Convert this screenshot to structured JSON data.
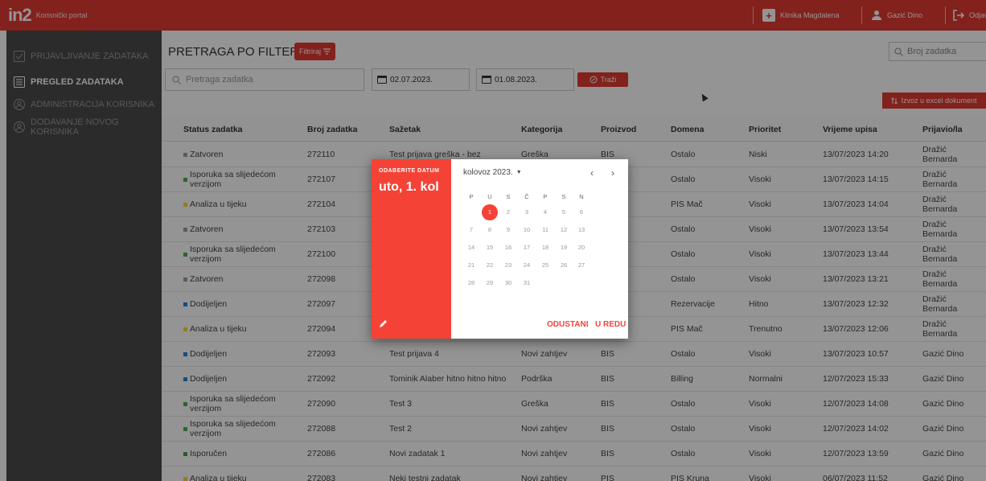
{
  "topbar": {
    "logo": "in2",
    "portal": "Korisnički portal",
    "clinic": "Klinika Magdalena",
    "user": "Gazić Dino",
    "logout": "Odjava"
  },
  "sidebar": {
    "items": [
      {
        "label": "PRIJAVLJIVANJE ZADATAKA",
        "icon": "task-icon"
      },
      {
        "label": "PREGLED ZADATAKA",
        "icon": "list-icon"
      },
      {
        "label": "ADMINISTRACIJA KORISNIKA",
        "icon": "users-icon"
      },
      {
        "label": "DODAVANJE NOVOG KORISNIKA",
        "icon": "add-user-icon"
      }
    ]
  },
  "main": {
    "title": "PRETRAGA PO FILTERIMA",
    "filter_label": "Filtriraj",
    "task_search_placeholder": "Pretraga zadatka",
    "number_search_placeholder": "Broj zadatka",
    "date_from": "02.07.2023.",
    "date_to": "01.08.2023.",
    "search_label": "Traži",
    "export_label": "Izvoz u excel dokument"
  },
  "table": {
    "headers": [
      "Status zadatka",
      "Broj zadatka",
      "Sažetak",
      "Kategorija",
      "Proizvod",
      "Domena",
      "Prioritet",
      "Vrijeme upisa",
      "Prijavio/la"
    ],
    "rows": [
      {
        "status": "Zatvoren",
        "color": "#9e9e9e",
        "num": "272110",
        "summary": "Test prijava greška - bez",
        "category": "Greška",
        "product": "BIS",
        "domain": "Ostalo",
        "priority": "Niski",
        "time": "13/07/2023 14:20",
        "reporter": "Dražić Bernarda"
      },
      {
        "status": "Isporuka sa slijedećom verzijom",
        "color": "#4caf50",
        "num": "272107",
        "summary": "",
        "category": "",
        "product": "",
        "domain": "Ostalo",
        "priority": "Visoki",
        "time": "13/07/2023 14:15",
        "reporter": "Dražić Bernarda"
      },
      {
        "status": "Analiza u tijeku",
        "color": "#fdd835",
        "num": "272104",
        "summary": "",
        "category": "",
        "product": "",
        "domain": "PIS Mač",
        "priority": "Visoki",
        "time": "13/07/2023 14:04",
        "reporter": "Dražić Bernarda"
      },
      {
        "status": "Zatvoren",
        "color": "#9e9e9e",
        "num": "272103",
        "summary": "",
        "category": "",
        "product": "",
        "domain": "Ostalo",
        "priority": "Visoki",
        "time": "13/07/2023 13:54",
        "reporter": "Dražić Bernarda"
      },
      {
        "status": "Isporuka sa slijedećom verzijom",
        "color": "#4caf50",
        "num": "272100",
        "summary": "",
        "category": "",
        "product": "",
        "domain": "Ostalo",
        "priority": "Visoki",
        "time": "13/07/2023 13:44",
        "reporter": "Dražić Bernarda"
      },
      {
        "status": "Zatvoren",
        "color": "#9e9e9e",
        "num": "272098",
        "summary": "",
        "category": "",
        "product": "",
        "domain": "Ostalo",
        "priority": "Visoki",
        "time": "13/07/2023 13:21",
        "reporter": "Dražić Bernarda"
      },
      {
        "status": "Dodijeljen",
        "color": "#1e88e5",
        "num": "272097",
        "summary": "",
        "category": "",
        "product": "",
        "domain": "Rezervacije",
        "priority": "Hitno",
        "time": "13/07/2023 12:32",
        "reporter": "Dražić Bernarda"
      },
      {
        "status": "Analiza u tijeku",
        "color": "#fdd835",
        "num": "272094",
        "summary": "",
        "category": "",
        "product": "",
        "domain": "PIS Mač",
        "priority": "Trenutno",
        "time": "13/07/2023 12:06",
        "reporter": "Dražić Bernarda"
      },
      {
        "status": "Dodijeljen",
        "color": "#1e88e5",
        "num": "272093",
        "summary": "Test prijava 4",
        "category": "Novi zahtjev",
        "product": "BIS",
        "domain": "Ostalo",
        "priority": "Visoki",
        "time": "13/07/2023 10:57",
        "reporter": "Gazić Dino"
      },
      {
        "status": "Dodijeljen",
        "color": "#1e88e5",
        "num": "272092",
        "summary": "Tominik Alaber hitno hitno hitno",
        "category": "Podrška",
        "product": "BIS",
        "domain": "Billing",
        "priority": "Normalni",
        "time": "12/07/2023 15:33",
        "reporter": "Gazić Dino"
      },
      {
        "status": "Isporuka sa slijedećom verzijom",
        "color": "#4caf50",
        "num": "272090",
        "summary": "Test 3",
        "category": "Greška",
        "product": "BIS",
        "domain": "Ostalo",
        "priority": "Visoki",
        "time": "12/07/2023 14:08",
        "reporter": "Gazić Dino"
      },
      {
        "status": "Isporuka sa slijedećom verzijom",
        "color": "#4caf50",
        "num": "272088",
        "summary": "Test 2",
        "category": "Novi zahtjev",
        "product": "BIS",
        "domain": "Ostalo",
        "priority": "Visoki",
        "time": "12/07/2023 14:02",
        "reporter": "Gazić Dino"
      },
      {
        "status": "Isporučen",
        "color": "#43a047",
        "num": "272086",
        "summary": "Novi zadatak 1",
        "category": "Novi zahtjev",
        "product": "BIS",
        "domain": "Ostalo",
        "priority": "Visoki",
        "time": "12/07/2023 13:59",
        "reporter": "Gazić Dino"
      },
      {
        "status": "Analiza u tijeku",
        "color": "#fdd835",
        "num": "272083",
        "summary": "Neki testni zadatak",
        "category": "Novi zahtjev",
        "product": "PIS",
        "domain": "PIS Kruna",
        "priority": "Visoki",
        "time": "06/07/2023 11:52",
        "reporter": "Gazić Dino"
      }
    ]
  },
  "datepicker": {
    "label": "ODABERITE DATUM",
    "selected_display": "uto, 1. kol",
    "month": "kolovoz 2023.",
    "weekdays": [
      "P",
      "U",
      "S",
      "Č",
      "P",
      "S",
      "N"
    ],
    "days": [
      "1",
      "2",
      "3",
      "4",
      "5",
      "6",
      "7",
      "8",
      "9",
      "10",
      "11",
      "12",
      "13",
      "14",
      "15",
      "16",
      "17",
      "18",
      "19",
      "20",
      "21",
      "22",
      "23",
      "24",
      "25",
      "26",
      "27",
      "28",
      "29",
      "30",
      "31"
    ],
    "selected_day": "1",
    "cancel": "ODUSTANI",
    "ok": "U REDU"
  }
}
